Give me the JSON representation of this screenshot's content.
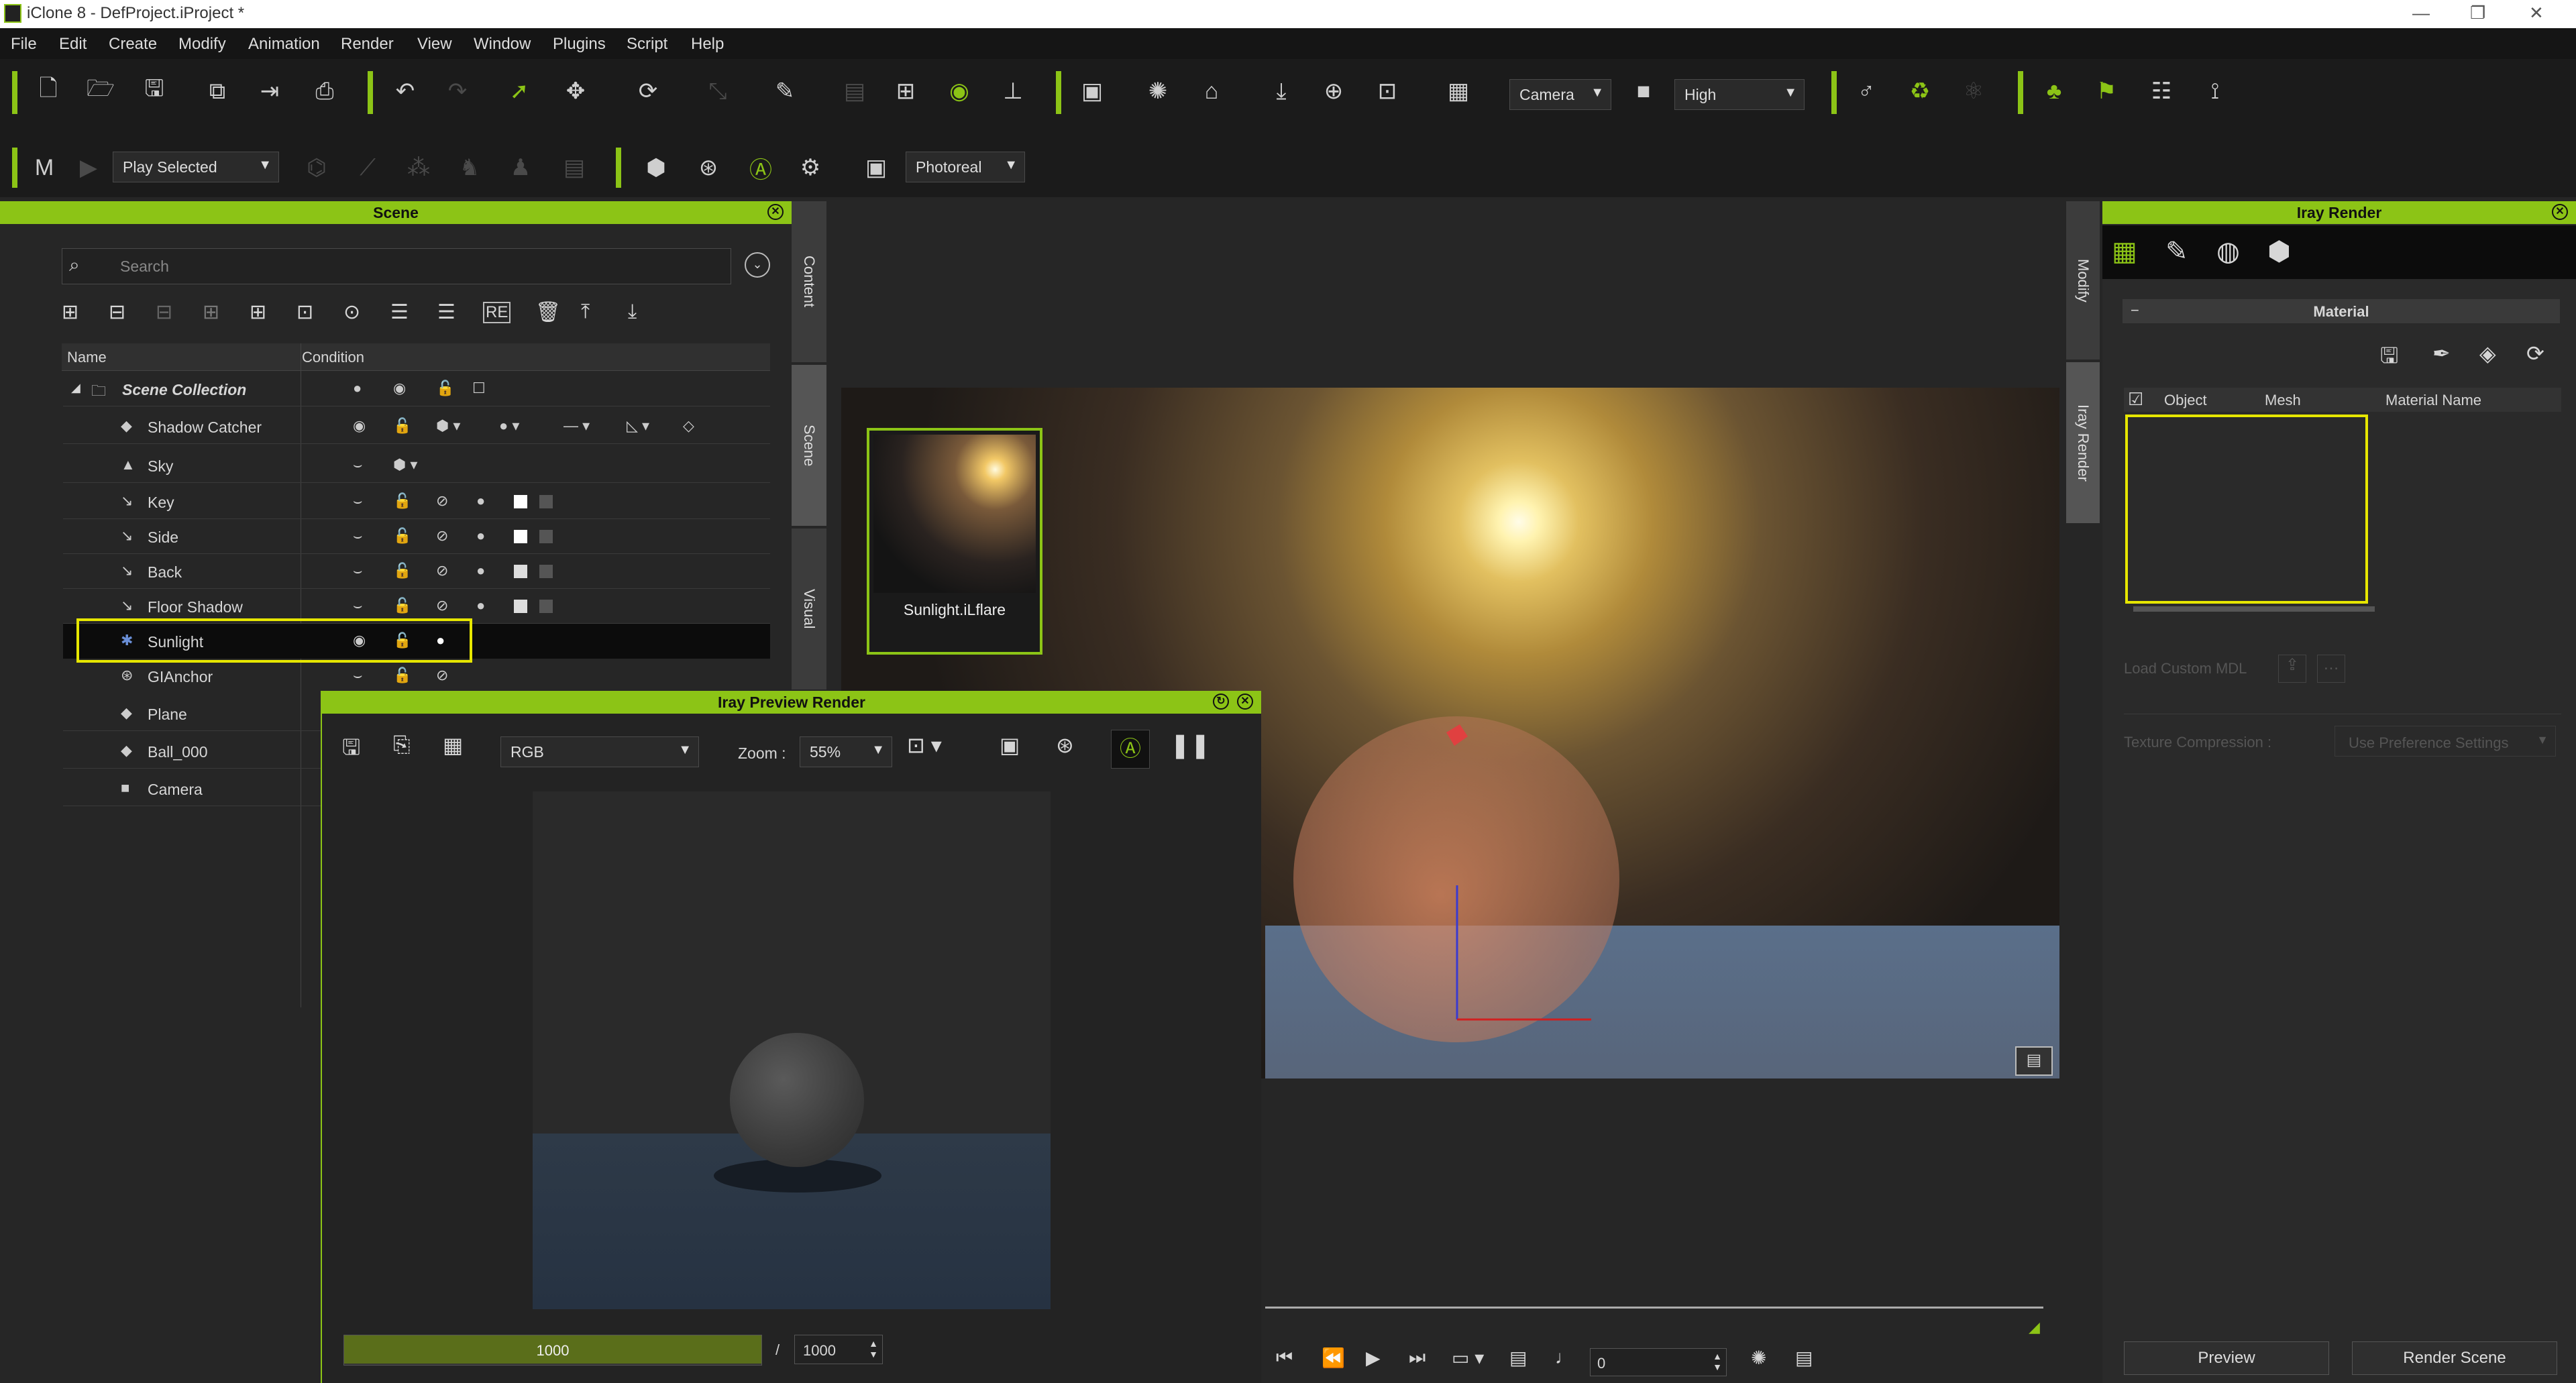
{
  "window": {
    "title": "iClone 8 - DefProject.iProject *"
  },
  "menu": [
    "File",
    "Edit",
    "Create",
    "Modify",
    "Animation",
    "Render",
    "View",
    "Window",
    "Plugins",
    "Script",
    "Help"
  ],
  "toolbar": {
    "camera_select": "Camera",
    "quality_select": "High"
  },
  "toolbar2": {
    "play_mode": "Play Selected",
    "render_mode": "Photoreal"
  },
  "scene_panel": {
    "title": "Scene",
    "search_placeholder": "Search",
    "col_name": "Name",
    "col_condition": "Condition",
    "tabs": [
      "Content",
      "Scene",
      "Visual"
    ],
    "rows": [
      {
        "label": "Scene Collection",
        "icon": "folder-icon"
      },
      {
        "label": "Shadow Catcher",
        "icon": "object-icon"
      },
      {
        "label": "Sky",
        "icon": "sky-icon"
      },
      {
        "label": "Key",
        "icon": "light-icon"
      },
      {
        "label": "Side",
        "icon": "light-icon"
      },
      {
        "label": "Back",
        "icon": "light-icon"
      },
      {
        "label": "Floor Shadow",
        "icon": "light-icon"
      },
      {
        "label": "Sunlight",
        "icon": "sun-icon",
        "selected": true
      },
      {
        "label": "GIAnchor",
        "icon": "anchor-icon"
      },
      {
        "label": "Plane",
        "icon": "object-icon"
      },
      {
        "label": "Ball_000",
        "icon": "object-icon"
      },
      {
        "label": "Camera",
        "icon": "camera-icon"
      }
    ]
  },
  "flare_thumb": {
    "label": "Sunlight.iLflare"
  },
  "preview_window": {
    "title": "Iray Preview Render",
    "channel": "RGB",
    "zoom_label": "Zoom :",
    "zoom_value": "55%",
    "progress_value": "1000",
    "progress_fraction": 1.0,
    "max_separator": "/",
    "max_value": "1000"
  },
  "timeline": {
    "frame": "0"
  },
  "right_tabs": [
    "Modify",
    "Iray Render"
  ],
  "iray_panel": {
    "title": "Iray Render",
    "section": "Material",
    "col_object": "Object",
    "col_mesh": "Mesh",
    "col_material": "Material Name",
    "load_mdl_label": "Load Custom MDL",
    "texture_compression_label": "Texture Compression :",
    "texture_compression_value": "Use Preference Settings",
    "preview_button": "Preview",
    "render_button": "Render Scene"
  },
  "colors": {
    "accent": "#8cc416",
    "highlight": "#e6e600",
    "panel_bg": "#262626"
  }
}
